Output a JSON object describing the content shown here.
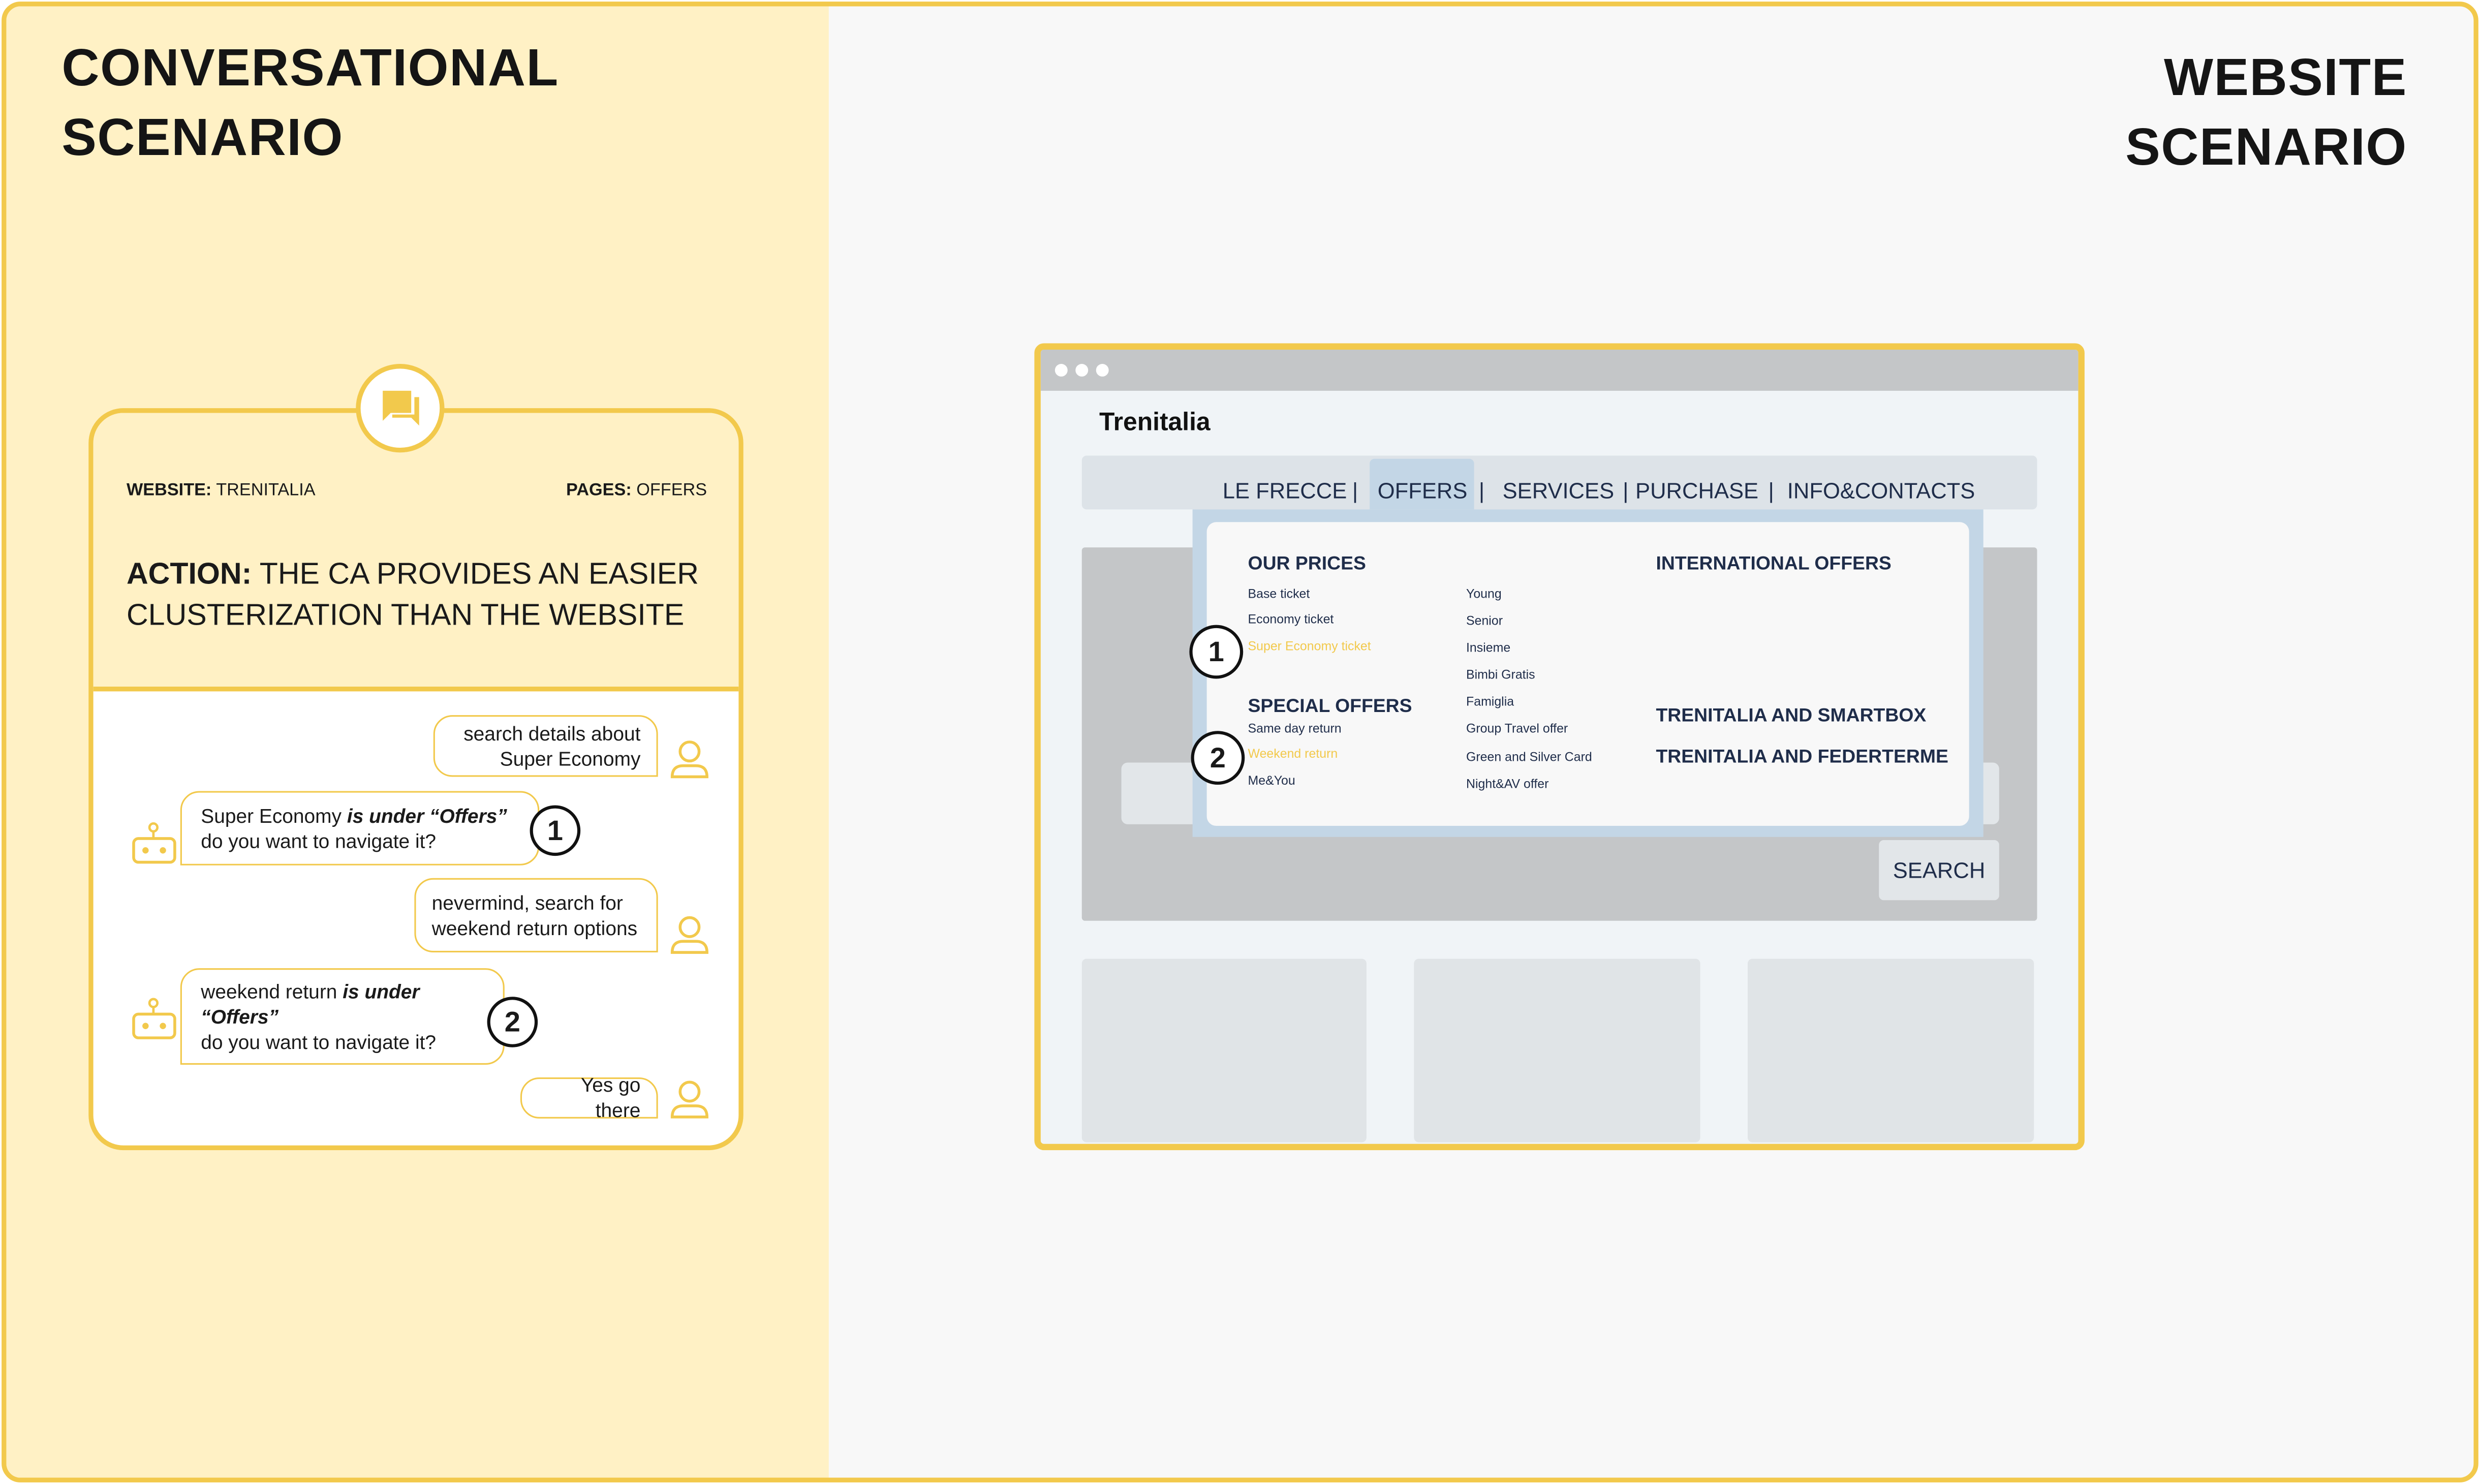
{
  "left_title": [
    "CONVERSATIONAL",
    "SCENARIO"
  ],
  "right_title": [
    "WEBSITE",
    "SCENARIO"
  ],
  "card": {
    "website_label": "WEBSITE:",
    "website_value": "TRENITALIA",
    "pages_label": "PAGES:",
    "pages_value": "OFFERS",
    "action_label": "ACTION:",
    "action_text": "THE CA PROVIDES AN EASIER CLUSTERIZATION THAN THE WEBSITE",
    "icon": "chat-bubbles-icon"
  },
  "chat": {
    "user1": [
      "search details about",
      "Super Economy"
    ],
    "bot1": {
      "a": "Super Economy ",
      "b": "is under “Offers”",
      "c": "do you want to navigate it?"
    },
    "user2": [
      "nevermind, search for",
      "weekend return options"
    ],
    "bot2": {
      "a": "weekend return ",
      "b": "is under",
      "c": "“Offers”",
      "d": "do you want to navigate it?"
    },
    "user3": "Yes go there",
    "markers": [
      "1",
      "2"
    ]
  },
  "website": {
    "brand": "Trenitalia",
    "nav": [
      "LE FRECCE",
      "OFFERS",
      "SERVICES",
      "PURCHASE",
      "INFO&CONTACTS"
    ],
    "separator": "|",
    "search_label": "SEARCH",
    "menu": {
      "our_prices": {
        "title": "OUR PRICES",
        "items": [
          "Base ticket",
          "Economy ticket",
          "Super Economy ticket"
        ]
      },
      "special_offers": {
        "title": "SPECIAL OFFERS",
        "items": [
          "Same day return",
          "Weekend return",
          "Me&You"
        ]
      },
      "col2": [
        "Young",
        "Senior",
        "Insieme",
        "Bimbi Gratis",
        "Famiglia",
        "Group Travel offer",
        "Green and Silver Card",
        "Night&AV offer"
      ],
      "col3": [
        "INTERNATIONAL OFFERS",
        "TRENITALIA AND SMARTBOX",
        "TRENITALIA AND FEDERTERME"
      ]
    },
    "markers": [
      "1",
      "2"
    ]
  },
  "colors": {
    "accent": "#F2C94C",
    "left_bg": "#FFF1C5",
    "navy": "#1f2d4a",
    "menu_blue": "#C3D6E6"
  }
}
